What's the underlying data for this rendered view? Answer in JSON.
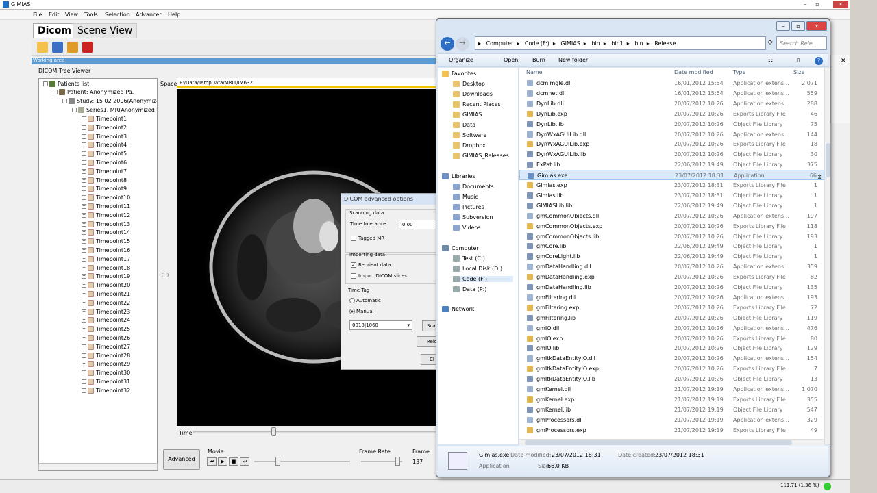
{
  "app": {
    "title": "GIMIAS",
    "menu": [
      "File",
      "Edit",
      "View",
      "Tools",
      "Selection",
      "Advanced",
      "Help"
    ],
    "tabs": [
      "Dicom",
      "Scene View"
    ],
    "working_area": "Working area",
    "viewer_label": "DICOM Tree Viewer",
    "space_label": "Space",
    "path": "P:/Data/TempData/MRI1/IM632",
    "zoom_status": "111.71  (1.36 %)"
  },
  "tree": {
    "patients": "Patients list",
    "patient": "Patient: Anonymized-Pa.",
    "study": "Study: 15 02 2006(Anonymized",
    "series": "Series1, MR(Anonymized w",
    "timepoints": [
      "Timepoint1",
      "Timepoint2",
      "Timepoint3",
      "Timepoint4",
      "Timepoint5",
      "Timepoint6",
      "Timepoint7",
      "Timepoint8",
      "Timepoint9",
      "Timepoint10",
      "Timepoint11",
      "Timepoint12",
      "Timepoint13",
      "Timepoint14",
      "Timepoint15",
      "Timepoint16",
      "Timepoint17",
      "Timepoint18",
      "Timepoint19",
      "Timepoint20",
      "Timepoint21",
      "Timepoint22",
      "Timepoint23",
      "Timepoint24",
      "Timepoint25",
      "Timepoint26",
      "Timepoint27",
      "Timepoint28",
      "Timepoint29",
      "Timepoint30",
      "Timepoint31",
      "Timepoint32"
    ]
  },
  "controls": {
    "time": "Time",
    "advanced": "Advanced",
    "movie": "Movie",
    "frame_rate": "Frame Rate",
    "frame": "Frame",
    "frame_value": "137",
    "time_position": 0.33,
    "movie_position": 0.24,
    "frame_rate_position": 0.88
  },
  "dialog": {
    "title": "DICOM advanced options",
    "scanning": "Scanning data",
    "time_tolerance_label": "Time tolerance",
    "time_tolerance_value": "0.00",
    "tagged_mr": "Tagged MR",
    "importing": "Importing data",
    "reorient": "Reorient data",
    "import_slices": "Import DICOM slices",
    "time_tag": "Time Tag",
    "automatic": "Automatic",
    "manual": "Manual",
    "tag_value": "0018|1060",
    "btn_scan": "Sca",
    "btn_reload": "Relo",
    "btn_close": "Cl"
  },
  "explorer": {
    "address": [
      "Computer",
      "Code (F:)",
      "GIMIAS",
      "bin",
      "bin1",
      "bin",
      "Release"
    ],
    "search_placeholder": "Search Rele...",
    "commands": [
      "Organize",
      "Open",
      "Burn",
      "New folder"
    ],
    "columns": [
      "Name",
      "Date modified",
      "Type",
      "Size"
    ],
    "nav": {
      "favorites": "Favorites",
      "fav_items": [
        "Desktop",
        "Downloads",
        "Recent Places",
        "GIMIAS",
        "Data",
        "Software",
        "Dropbox",
        "GIMIAS_Releases"
      ],
      "libraries": "Libraries",
      "lib_items": [
        "Documents",
        "Music",
        "Pictures",
        "Subversion",
        "Videos"
      ],
      "computer": "Computer",
      "comp_items": [
        "Test (C:)",
        "Local Disk (D:)",
        "Code (F:)",
        "Data (P:)"
      ],
      "network": "Network"
    },
    "files": [
      {
        "name": "dcmimgle.dll",
        "date": "16/01/2012 15:54",
        "type": "Application extens...",
        "size": "2.071"
      },
      {
        "name": "dcmnet.dll",
        "date": "16/01/2012 15:54",
        "type": "Application extens...",
        "size": "559"
      },
      {
        "name": "DynLib.dll",
        "date": "20/07/2012 10:26",
        "type": "Application extens...",
        "size": "288"
      },
      {
        "name": "DynLib.exp",
        "date": "20/07/2012 10:26",
        "type": "Exports Library File",
        "size": "46"
      },
      {
        "name": "DynLib.lib",
        "date": "20/07/2012 10:26",
        "type": "Object File Library",
        "size": "75"
      },
      {
        "name": "DynWxAGUILib.dll",
        "date": "20/07/2012 10:26",
        "type": "Application extens...",
        "size": "144"
      },
      {
        "name": "DynWxAGUILib.exp",
        "date": "20/07/2012 10:26",
        "type": "Exports Library File",
        "size": "18"
      },
      {
        "name": "DynWxAGUILib.lib",
        "date": "20/07/2012 10:26",
        "type": "Object File Library",
        "size": "30"
      },
      {
        "name": "ExPat.lib",
        "date": "22/06/2012 19:49",
        "type": "Object File Library",
        "size": "375"
      },
      {
        "name": "Gimias.exe",
        "date": "23/07/2012 18:31",
        "type": "Application",
        "size": "66"
      },
      {
        "name": "Gimias.exp",
        "date": "23/07/2012 18:31",
        "type": "Exports Library File",
        "size": "1"
      },
      {
        "name": "Gimias.lib",
        "date": "23/07/2012 18:31",
        "type": "Object File Library",
        "size": "1"
      },
      {
        "name": "GIMIASLib.lib",
        "date": "22/06/2012 19:49",
        "type": "Object File Library",
        "size": "1"
      },
      {
        "name": "gmCommonObjects.dll",
        "date": "20/07/2012 10:26",
        "type": "Application extens...",
        "size": "197"
      },
      {
        "name": "gmCommonObjects.exp",
        "date": "20/07/2012 10:26",
        "type": "Exports Library File",
        "size": "118"
      },
      {
        "name": "gmCommonObjects.lib",
        "date": "20/07/2012 10:26",
        "type": "Object File Library",
        "size": "193"
      },
      {
        "name": "gmCore.lib",
        "date": "22/06/2012 19:49",
        "type": "Object File Library",
        "size": "1"
      },
      {
        "name": "gmCoreLight.lib",
        "date": "22/06/2012 19:49",
        "type": "Object File Library",
        "size": "1"
      },
      {
        "name": "gmDataHandling.dll",
        "date": "20/07/2012 10:26",
        "type": "Application extens...",
        "size": "359"
      },
      {
        "name": "gmDataHandling.exp",
        "date": "20/07/2012 10:26",
        "type": "Exports Library File",
        "size": "82"
      },
      {
        "name": "gmDataHandling.lib",
        "date": "20/07/2012 10:26",
        "type": "Object File Library",
        "size": "135"
      },
      {
        "name": "gmFiltering.dll",
        "date": "20/07/2012 10:26",
        "type": "Application extens...",
        "size": "193"
      },
      {
        "name": "gmFiltering.exp",
        "date": "20/07/2012 10:26",
        "type": "Exports Library File",
        "size": "72"
      },
      {
        "name": "gmFiltering.lib",
        "date": "20/07/2012 10:26",
        "type": "Object File Library",
        "size": "119"
      },
      {
        "name": "gmIO.dll",
        "date": "20/07/2012 10:26",
        "type": "Application extens...",
        "size": "476"
      },
      {
        "name": "gmIO.exp",
        "date": "20/07/2012 10:26",
        "type": "Exports Library File",
        "size": "80"
      },
      {
        "name": "gmIO.lib",
        "date": "20/07/2012 10:26",
        "type": "Object File Library",
        "size": "129"
      },
      {
        "name": "gmItkDataEntityIO.dll",
        "date": "20/07/2012 10:26",
        "type": "Application extens...",
        "size": "154"
      },
      {
        "name": "gmItkDataEntityIO.exp",
        "date": "20/07/2012 10:26",
        "type": "Exports Library File",
        "size": "7"
      },
      {
        "name": "gmItkDataEntityIO.lib",
        "date": "20/07/2012 10:26",
        "type": "Object File Library",
        "size": "13"
      },
      {
        "name": "gmKernel.dll",
        "date": "21/07/2012 19:19",
        "type": "Application extens...",
        "size": "1.070"
      },
      {
        "name": "gmKernel.exp",
        "date": "21/07/2012 19:19",
        "type": "Exports Library File",
        "size": "355"
      },
      {
        "name": "gmKernel.lib",
        "date": "21/07/2012 19:19",
        "type": "Object File Library",
        "size": "547"
      },
      {
        "name": "gmProcessors.dll",
        "date": "21/07/2012 19:19",
        "type": "Application extens...",
        "size": "329"
      },
      {
        "name": "gmProcessors.exp",
        "date": "21/07/2012 19:19",
        "type": "Exports Library File",
        "size": "49"
      }
    ],
    "selected_index": 9,
    "details": {
      "name": "Gimias.exe",
      "modified_label": "Date modified:",
      "modified": "23/07/2012 18:31",
      "created_label": "Date created:",
      "created": "23/07/2012 18:31",
      "type": "Application",
      "size_label": "Size:",
      "size": "66,0 KB"
    }
  },
  "colors": {
    "accent": "#5b9bd5",
    "path_underline": "#f5c400",
    "selection": "#dce9f8"
  }
}
